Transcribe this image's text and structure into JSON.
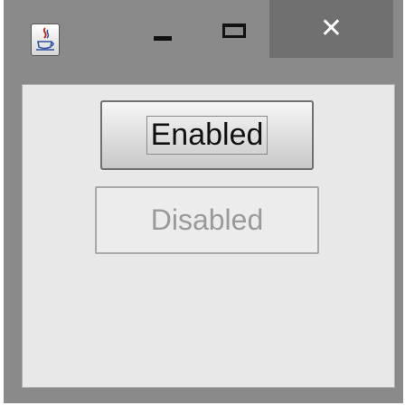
{
  "window": {
    "icons": {
      "app": "java-coffee-cup-icon",
      "minimize": "minimize-icon",
      "maximize": "maximize-icon",
      "close": "close-icon"
    },
    "close_glyph": "✕",
    "colors": {
      "frame": "#8a8a8a",
      "close_bg": "#707070",
      "content_bg": "#e8e8e8"
    }
  },
  "content": {
    "enabled_button": {
      "label": "Enabled",
      "enabled": true
    },
    "disabled_button": {
      "label": "Disabled",
      "enabled": false
    }
  }
}
